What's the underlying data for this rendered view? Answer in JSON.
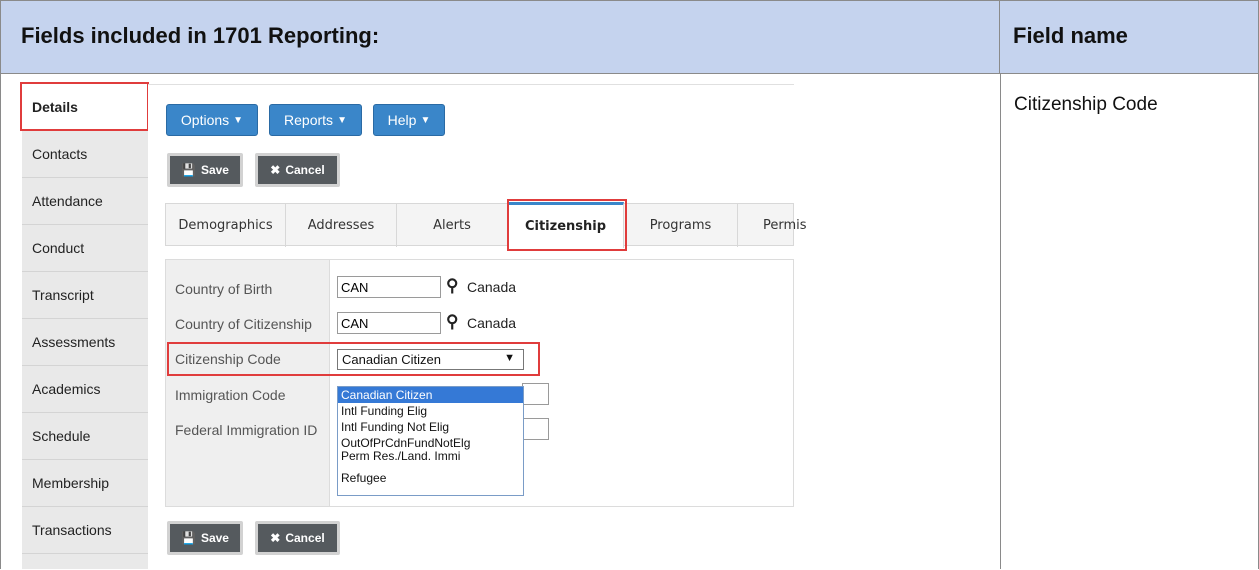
{
  "doc": {
    "header_left": "Fields included in 1701 Reporting:",
    "header_right": "Field name",
    "field_name_value": "Citizenship Code"
  },
  "sidebar": {
    "items": [
      {
        "label": "Details"
      },
      {
        "label": "Contacts"
      },
      {
        "label": "Attendance"
      },
      {
        "label": "Conduct"
      },
      {
        "label": "Transcript"
      },
      {
        "label": "Assessments"
      },
      {
        "label": "Academics"
      },
      {
        "label": "Schedule"
      },
      {
        "label": "Membership"
      },
      {
        "label": "Transactions"
      }
    ]
  },
  "toolbar": {
    "options_label": "Options",
    "reports_label": "Reports",
    "help_label": "Help",
    "save_label": "Save",
    "cancel_label": "Cancel"
  },
  "tabs": [
    {
      "label": "Demographics"
    },
    {
      "label": "Addresses"
    },
    {
      "label": "Alerts"
    },
    {
      "label": "Citizenship"
    },
    {
      "label": "Programs"
    },
    {
      "label": "Permis"
    }
  ],
  "form": {
    "country_birth_label": "Country of Birth",
    "country_birth_value": "CAN",
    "country_birth_name": "Canada",
    "country_citizenship_label": "Country of Citizenship",
    "country_citizenship_value": "CAN",
    "country_citizenship_name": "Canada",
    "citizenship_code_label": "Citizenship Code",
    "citizenship_code_value": "Canadian Citizen",
    "immigration_code_label": "Immigration Code",
    "federal_immigration_label": "Federal Immigration ID",
    "dropdown_options": [
      "Canadian Citizen",
      "Intl Funding Elig",
      "Intl Funding Not Elig",
      "OutOfPrCdnFundNotElg",
      "Perm Res./Land. Immi",
      "Refugee"
    ]
  },
  "colors": {
    "header_bg": "#c5d3ee",
    "highlight_red": "#e03c3c",
    "button_blue": "#3a86c9",
    "selected_option": "#3579d6"
  }
}
